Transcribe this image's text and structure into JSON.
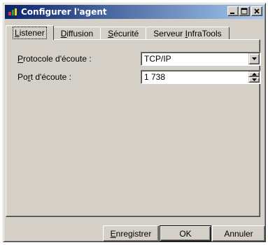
{
  "window": {
    "title": "Configurer l'agent",
    "controls": {
      "minimize_icon": "minimize-icon",
      "maximize_icon": "maximize-icon",
      "close_icon": "close-icon"
    },
    "title_gradient": [
      "#0a246a",
      "#a6caf0"
    ]
  },
  "tabs": [
    {
      "label_pre": "",
      "label_ul": "L",
      "label_post": "istener",
      "active": true
    },
    {
      "label_pre": "",
      "label_ul": "D",
      "label_post": "iffusion",
      "active": false
    },
    {
      "label_pre": "",
      "label_ul": "S",
      "label_post": "écurité",
      "active": false
    },
    {
      "label_pre": "Serveur ",
      "label_ul": "I",
      "label_post": "nfraTools",
      "active": false
    }
  ],
  "fields": {
    "protocol": {
      "label_pre": "",
      "label_ul": "P",
      "label_post": "rotocole d'écoute :",
      "value": "TCP/IP"
    },
    "port": {
      "label_pre": "Po",
      "label_ul": "r",
      "label_post": "t d'écoute :",
      "value": "1 738"
    }
  },
  "buttons": {
    "save": {
      "label_pre": "",
      "label_ul": "E",
      "label_post": "nregistrer"
    },
    "ok": {
      "label": "OK"
    },
    "cancel": {
      "label": "Annuler"
    }
  },
  "colors": {
    "face": "#d4d0c8",
    "title_text": "#ffffff"
  }
}
